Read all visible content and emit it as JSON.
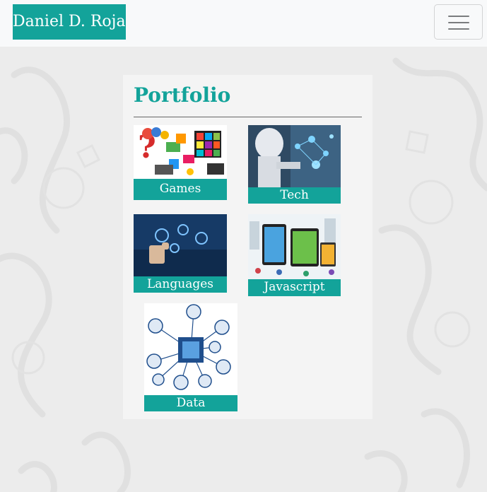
{
  "navbar": {
    "brand": "Daniel D. Rojas",
    "toggle_icon": "hamburger-menu-icon"
  },
  "portfolio": {
    "title": "Portfolio",
    "items": [
      {
        "label": "Games",
        "image": "games-collage-image"
      },
      {
        "label": "Tech",
        "image": "robot-image"
      },
      {
        "label": "Languages",
        "image": "touchscreen-image"
      },
      {
        "label": "Javascript",
        "image": "devices-city-image"
      },
      {
        "label": "Data",
        "image": "data-network-diagram-image"
      }
    ]
  },
  "colors": {
    "accent": "#13a39a",
    "navbar_bg": "#f8f9fa",
    "card_bg": "#f4f4f4",
    "page_bg": "#ececec"
  }
}
